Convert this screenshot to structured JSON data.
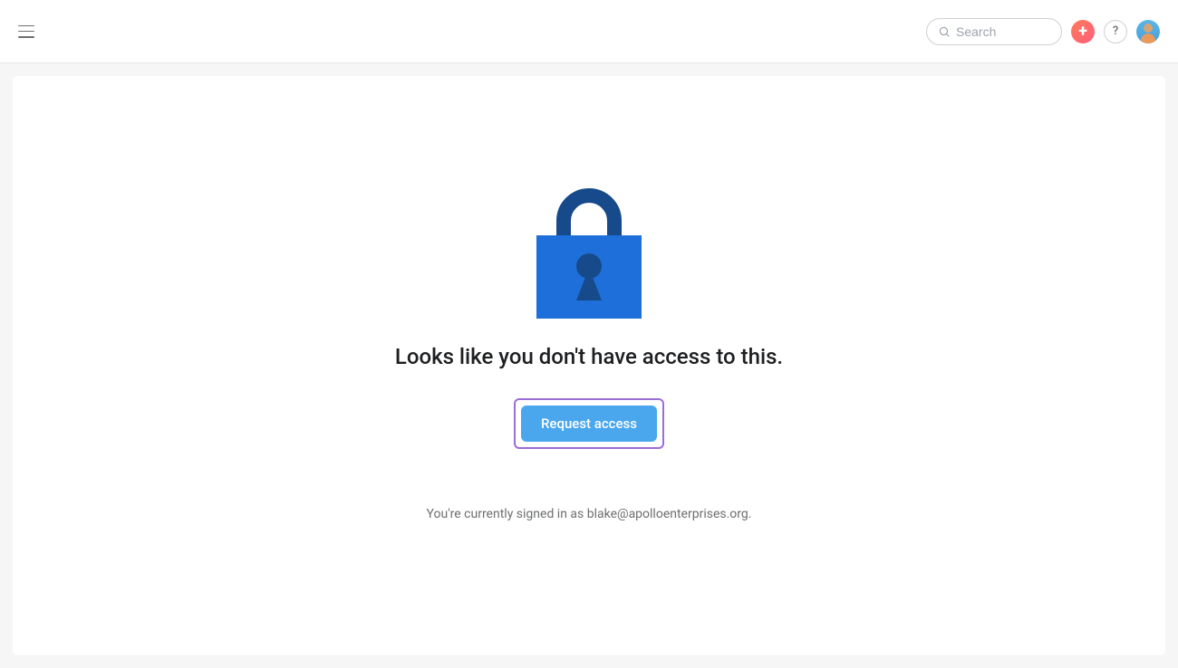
{
  "header": {
    "search_placeholder": "Search",
    "add_label": "+",
    "help_label": "?"
  },
  "main": {
    "heading": "Looks like you don't have access to this.",
    "request_button_label": "Request access",
    "signed_in_text": "You're currently signed in as blake@apolloenterprises.org."
  },
  "icons": {
    "lock": "lock-icon"
  },
  "colors": {
    "lock_body": "#1e6fd9",
    "lock_shackle": "#164a8a",
    "lock_keyhole": "#164a8a",
    "button_bg": "#4aa7ee",
    "highlight_border": "#9a6dd7"
  }
}
